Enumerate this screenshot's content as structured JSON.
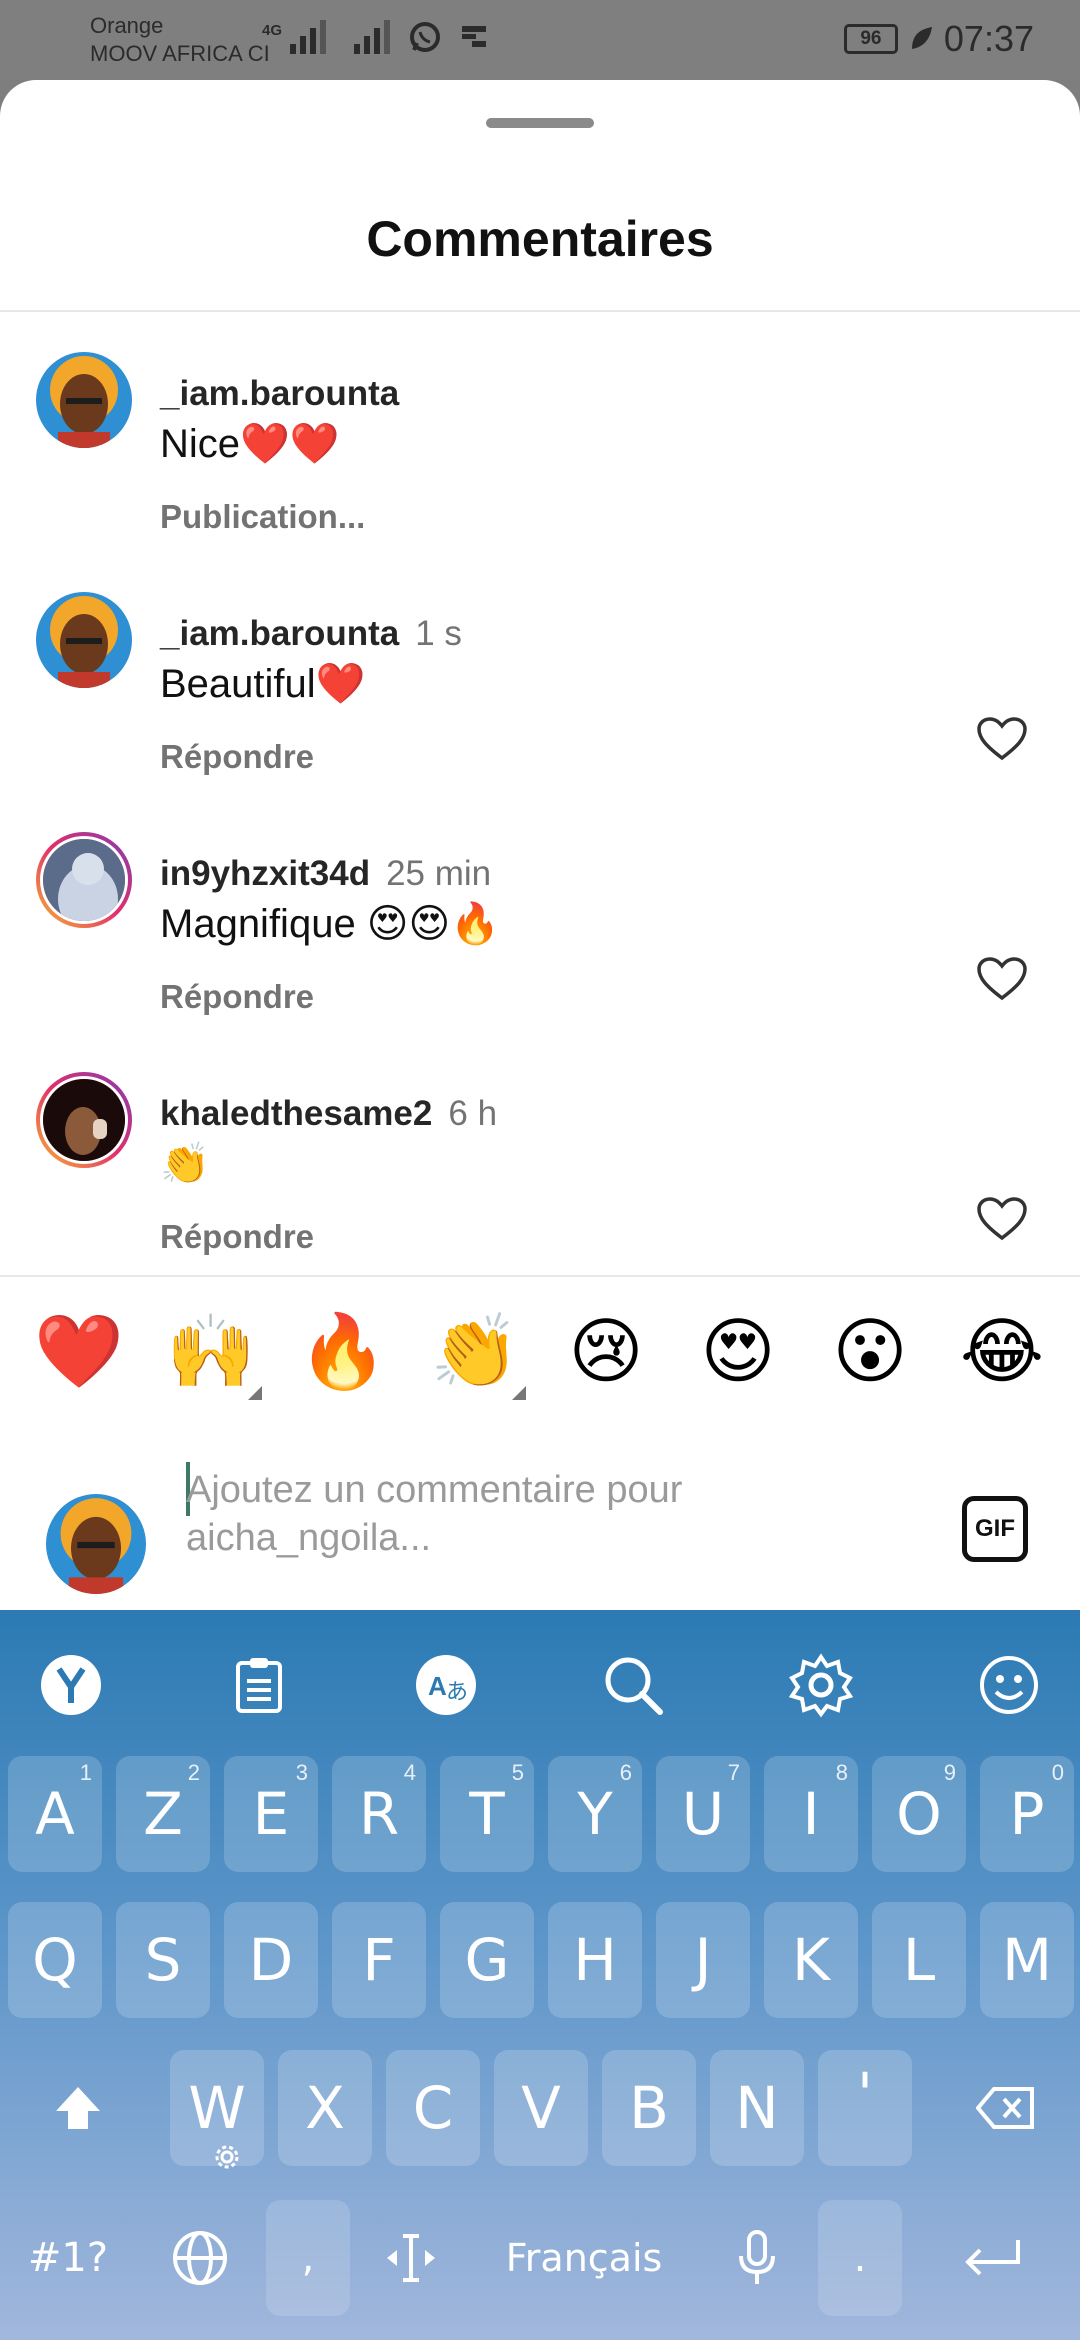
{
  "status_bar": {
    "carrier_1": "Orange",
    "carrier_2": "MOOV AFRICA CI",
    "network": "4G",
    "battery": "96",
    "time": "07:37"
  },
  "sheet": {
    "title": "Commentaires"
  },
  "comments": [
    {
      "username": "_iam.barounta",
      "time": "",
      "text": "Nice❤️❤️",
      "action": "Publication..."
    },
    {
      "username": "_iam.barounta",
      "time": "1 s",
      "text": "Beautiful❤️",
      "action": "Répondre"
    },
    {
      "username": "in9yhzxit34d",
      "time": "25 min",
      "text": "Magnifique 😍😍🔥",
      "action": "Répondre"
    },
    {
      "username": "khaledthesame2",
      "time": "6 h",
      "text": "👏",
      "action": "Répondre"
    }
  ],
  "quick_emojis": [
    "❤️",
    "🙌",
    "🔥",
    "👏",
    "😢",
    "😍",
    "😮",
    "😂"
  ],
  "composer": {
    "placeholder": "Ajoutez un commentaire pour aicha_ngoila...",
    "gif_label": "GIF"
  },
  "keyboard": {
    "toolbar_icons": [
      "yandex-icon",
      "clipboard-icon",
      "translate-icon",
      "search-icon",
      "settings-icon",
      "emoji-icon"
    ],
    "row1": [
      {
        "label": "A",
        "num": "1"
      },
      {
        "label": "Z",
        "num": "2"
      },
      {
        "label": "E",
        "num": "3"
      },
      {
        "label": "R",
        "num": "4"
      },
      {
        "label": "T",
        "num": "5"
      },
      {
        "label": "Y",
        "num": "6"
      },
      {
        "label": "U",
        "num": "7"
      },
      {
        "label": "I",
        "num": "8"
      },
      {
        "label": "O",
        "num": "9"
      },
      {
        "label": "P",
        "num": "0"
      }
    ],
    "row2": [
      "Q",
      "S",
      "D",
      "F",
      "G",
      "H",
      "J",
      "K",
      "L",
      "M"
    ],
    "row3": [
      "W",
      "X",
      "C",
      "V",
      "B",
      "N",
      "'"
    ],
    "symbols_label": "#1?",
    "comma_label": ",",
    "space_label": "Français",
    "period_label": "."
  },
  "colors": {
    "heart_red": "#e8252d",
    "keyboard_top": "#2b7ab3",
    "keyboard_bottom": "#a2b7dc"
  }
}
